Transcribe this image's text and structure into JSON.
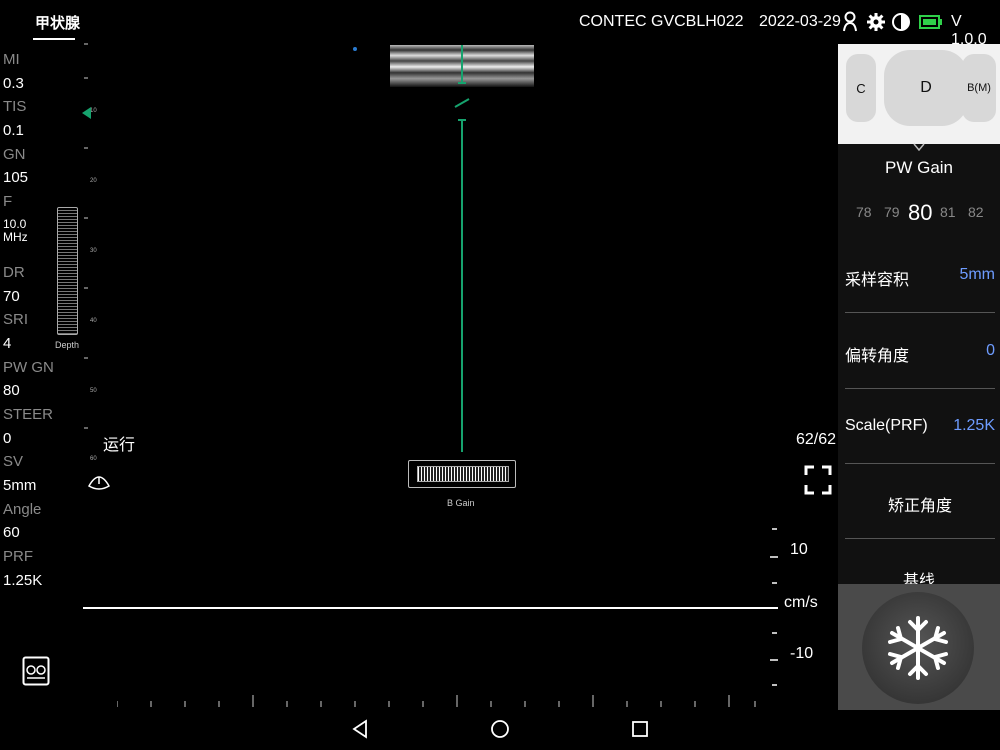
{
  "header": {
    "preset": "甲状腺",
    "device": "CONTEC GVCBLH022",
    "date": "2022-03-29",
    "version": "V 1.0.0"
  },
  "params": [
    {
      "label": "MI",
      "value": "0.3"
    },
    {
      "label": "TIS",
      "value": "0.1"
    },
    {
      "label": "GN",
      "value": "105"
    },
    {
      "label": "F",
      "value": "10.0\nMHz"
    },
    {
      "label": "DR",
      "value": "70"
    },
    {
      "label": "SRI",
      "value": "4"
    },
    {
      "label": "PW GN",
      "value": "80"
    },
    {
      "label": "STEER",
      "value": "0"
    },
    {
      "label": "SV",
      "value": "5mm"
    },
    {
      "label": "Angle",
      "value": "60"
    },
    {
      "label": "PRF",
      "value": "1.25K"
    }
  ],
  "depth_ticks": [
    "10",
    "20",
    "30",
    "40",
    "50",
    "60"
  ],
  "depth_label": "Depth",
  "run_label": "运行",
  "b_gain_label": "B Gain",
  "frame_count": "62/62",
  "velocity": {
    "pos": "10",
    "unit": "cm/s",
    "neg": "-10"
  },
  "modes": {
    "left": "C",
    "center": "D",
    "right": "B(M)"
  },
  "pw_gain": {
    "title": "PW Gain",
    "values": [
      "78",
      "79",
      "80",
      "81",
      "82"
    ],
    "current": "80"
  },
  "settings": [
    {
      "label": "采样容积",
      "value": "5mm"
    },
    {
      "label": "偏转角度",
      "value": "0"
    },
    {
      "label": "Scale(PRF)",
      "value": "1.25K"
    },
    {
      "label": "矫正角度",
      "value": ""
    },
    {
      "label": "基线",
      "value": ""
    }
  ],
  "icons": {
    "person": "person-icon",
    "settings": "gear-icon",
    "contrast": "contrast-icon",
    "battery": "battery-icon",
    "fullscreen": "fullscreen-icon",
    "freeze": "snowflake-icon",
    "probe": "probe-icon",
    "video": "video-record-icon"
  },
  "colors": {
    "accent": "#6e9cff",
    "cursor": "#16a36e",
    "battery": "#2fd14a"
  }
}
